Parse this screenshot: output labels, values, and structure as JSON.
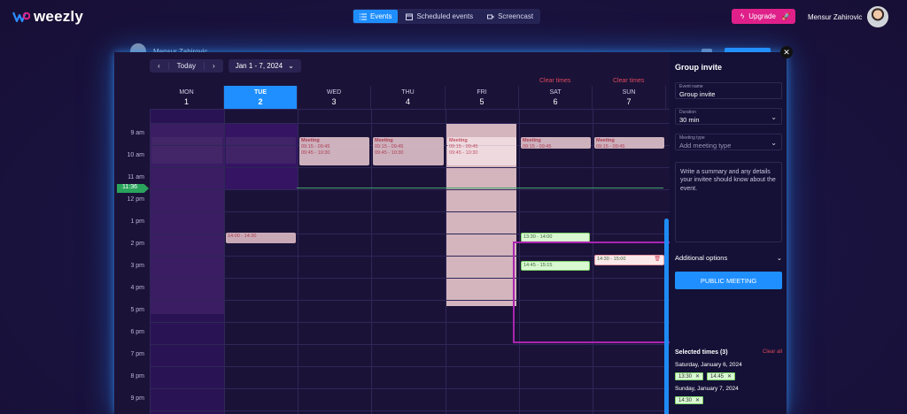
{
  "app": {
    "brand": "weezly",
    "nav": [
      {
        "label": "Events",
        "icon": "list-icon",
        "active": true
      },
      {
        "label": "Scheduled events",
        "icon": "calendar-icon",
        "active": false
      },
      {
        "label": "Screencast",
        "icon": "camera-icon",
        "active": false
      }
    ],
    "upgrade_label": "Upgrade",
    "user_name": "Mensur Zahirovic",
    "background_user_name": "Mensur Zahirovic"
  },
  "toolbar": {
    "prev": "‹",
    "today": "Today",
    "next": "›",
    "range": "Jan 1 - 7, 2024"
  },
  "days": [
    {
      "name": "MON",
      "num": "1",
      "today": false,
      "clear": ""
    },
    {
      "name": "TUE",
      "num": "2",
      "today": true,
      "clear": ""
    },
    {
      "name": "WED",
      "num": "3",
      "today": false,
      "clear": ""
    },
    {
      "name": "THU",
      "num": "4",
      "today": false,
      "clear": ""
    },
    {
      "name": "FRI",
      "num": "5",
      "today": false,
      "clear": ""
    },
    {
      "name": "SAT",
      "num": "6",
      "today": false,
      "clear": "Clear times"
    },
    {
      "name": "SUN",
      "num": "7",
      "today": false,
      "clear": "Clear times"
    }
  ],
  "hours": [
    "9 am",
    "10 am",
    "11 am",
    "12 pm",
    "1 pm",
    "2 pm",
    "3 pm",
    "4 pm",
    "5 pm",
    "6 pm",
    "7 pm",
    "8 pm",
    "9 pm"
  ],
  "now_label": "11:36",
  "events": [
    {
      "title": "Meeting",
      "times": [
        "09:15 - 09:45",
        "09:45 - 10:30"
      ]
    },
    {
      "title": "Meeting",
      "times": [
        "09:15 - 09:45",
        "09:45 - 10:30"
      ]
    },
    {
      "title": "Meeting",
      "times": [
        "09:15 - 09:45",
        "09:45 - 10:30"
      ]
    },
    {
      "title": "Meeting",
      "times": [
        "09:15 - 09:45"
      ]
    },
    {
      "title": "Meeting",
      "times": [
        "09:15 - 09:45"
      ]
    }
  ],
  "tue_event": "14:00 - 14:30",
  "slots": {
    "sat_1": "13:30 - 14:00",
    "sat_2": "14:45 - 15:15",
    "sun_1": "14:30 - 15:00"
  },
  "panel": {
    "title": "Group invite",
    "event_name_label": "Event name",
    "event_name_value": "Group invite",
    "duration_label": "Duration",
    "duration_value": "30 min",
    "meeting_type_label": "Meeting type",
    "meeting_type_placeholder": "Add meeting type",
    "summary_placeholder": "Write a summary and any details your invitee should know about the event.",
    "additional_options": "Additional options",
    "public_button": "PUBLIC MEETING",
    "selected_title": "Selected times (3)",
    "clear_all": "Clear all",
    "groups": [
      {
        "date": "Saturday, January 6, 2024",
        "times": [
          "13:30",
          "14:45"
        ]
      },
      {
        "date": "Sunday, January 7, 2024",
        "times": [
          "14:30"
        ]
      }
    ]
  },
  "colors": {
    "accent": "#1f8fff",
    "upgrade": "#e0218a",
    "now": "#2aa35c",
    "highlight": "#a925b0"
  }
}
